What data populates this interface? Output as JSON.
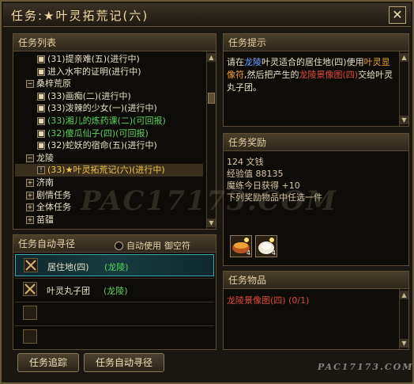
{
  "window": {
    "title": "任务:★叶灵拓荒记(六)",
    "close_label": "✕"
  },
  "task_list": {
    "header": "任务列表",
    "rows": [
      {
        "indent": 28,
        "box": "■",
        "parts": [
          {
            "t": "(31)提亲难(五)(进行中)",
            "c": "c-white"
          }
        ]
      },
      {
        "indent": 28,
        "box": "■",
        "parts": [
          {
            "t": "进入水牢的证明(进行中)",
            "c": "c-white"
          }
        ]
      },
      {
        "indent": 14,
        "box": "−",
        "parts": [
          {
            "t": "桑梓荒原",
            "c": "c-white"
          }
        ]
      },
      {
        "indent": 28,
        "box": "■",
        "parts": [
          {
            "t": "(33)画痴(二)(进行中)",
            "c": "c-white"
          }
        ]
      },
      {
        "indent": 28,
        "box": "■",
        "parts": [
          {
            "t": "(33)泼辣的少女(一)(进行中)",
            "c": "c-white"
          }
        ]
      },
      {
        "indent": 28,
        "box": "■",
        "parts": [
          {
            "t": "(33)湘儿的炼药课(二)(可回报)",
            "c": "c-green"
          }
        ]
      },
      {
        "indent": 28,
        "box": "■",
        "parts": [
          {
            "t": "(32)傻瓜仙子(四)(可回报)",
            "c": "c-green"
          }
        ]
      },
      {
        "indent": 28,
        "box": "■",
        "parts": [
          {
            "t": "(32)蛇妖的宿命(五)(进行中)",
            "c": "c-white"
          }
        ]
      },
      {
        "indent": 14,
        "box": "−",
        "parts": [
          {
            "t": "龙陵",
            "c": "c-white"
          }
        ]
      },
      {
        "indent": 28,
        "box": "!",
        "selected": true,
        "parts": [
          {
            "t": "(33)★叶灵拓荒记(六)(进行中)",
            "c": "c-yellow"
          }
        ]
      },
      {
        "indent": 14,
        "box": "+",
        "parts": [
          {
            "t": "济南",
            "c": "c-white"
          }
        ]
      },
      {
        "indent": 14,
        "box": "+",
        "parts": [
          {
            "t": "剧情任务",
            "c": "c-white"
          }
        ]
      },
      {
        "indent": 14,
        "box": "+",
        "parts": [
          {
            "t": "全体任务",
            "c": "c-white"
          }
        ]
      },
      {
        "indent": 14,
        "box": "+",
        "parts": [
          {
            "t": "苗疆",
            "c": "c-white"
          }
        ]
      }
    ]
  },
  "auto_path": {
    "header": "任务自动寻径",
    "auto_use_label": "自动使用",
    "auto_use_target": "御空符",
    "rows": [
      {
        "label": "居住地(四)",
        "place": "(龙陵)",
        "active": true
      },
      {
        "label": "叶灵丸子团",
        "place": "(龙陵)",
        "active": false
      },
      {
        "label": "",
        "place": "",
        "active": false
      },
      {
        "label": "",
        "place": "",
        "active": false
      }
    ],
    "track_button": "任务追踪",
    "auto_path_button": "任务自动寻径"
  },
  "hint": {
    "header": "任务提示",
    "segments": [
      {
        "t": "请在",
        "c": "c-white"
      },
      {
        "t": "龙陵",
        "c": "c-blue"
      },
      {
        "t": "叶灵适合的居住地(四)使用",
        "c": "c-white"
      },
      {
        "t": "叶灵显像符",
        "c": "c-orange"
      },
      {
        "t": ",然后把产生的",
        "c": "c-white"
      },
      {
        "t": "龙陵景像图(四)",
        "c": "c-red"
      },
      {
        "t": "交给",
        "c": "c-white"
      },
      {
        "t": "叶灵丸子团",
        "c": "c-white"
      },
      {
        "t": "。",
        "c": "c-white"
      }
    ]
  },
  "reward": {
    "header": "任务奖励",
    "money": "124 文钱",
    "exp": "经验值 88135",
    "cultivation": "魔练今日获得 +10",
    "choice_note": "下列奖励物品中任选一件",
    "items": [
      {
        "icon": "orange-bowl-icon",
        "count": "4"
      },
      {
        "icon": "white-bun-icon",
        "count": "4"
      }
    ]
  },
  "task_items": {
    "header": "任务物品",
    "line": "龙陵景像图(四)  (0/1)"
  },
  "watermarks": {
    "main": "PAC17173.COM",
    "corner": "PAC17173.COM"
  }
}
